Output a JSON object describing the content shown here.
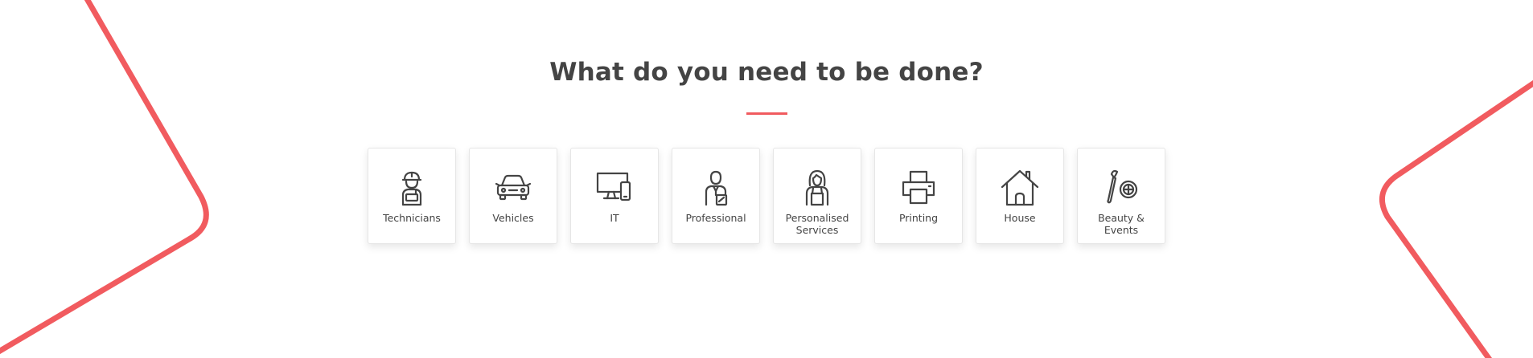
{
  "heading": "What do you need to be done?",
  "accent_color": "#f15b5f",
  "categories": [
    {
      "label": "Technicians",
      "icon": "technician-icon"
    },
    {
      "label": "Vehicles",
      "icon": "car-icon"
    },
    {
      "label": "IT",
      "icon": "computer-devices-icon"
    },
    {
      "label": "Professional",
      "icon": "professional-person-icon"
    },
    {
      "label": "Personalised Services",
      "icon": "woman-apron-icon"
    },
    {
      "label": "Printing",
      "icon": "printer-icon"
    },
    {
      "label": "House",
      "icon": "house-icon"
    },
    {
      "label": "Beauty & Events",
      "icon": "makeup-brush-icon"
    }
  ]
}
